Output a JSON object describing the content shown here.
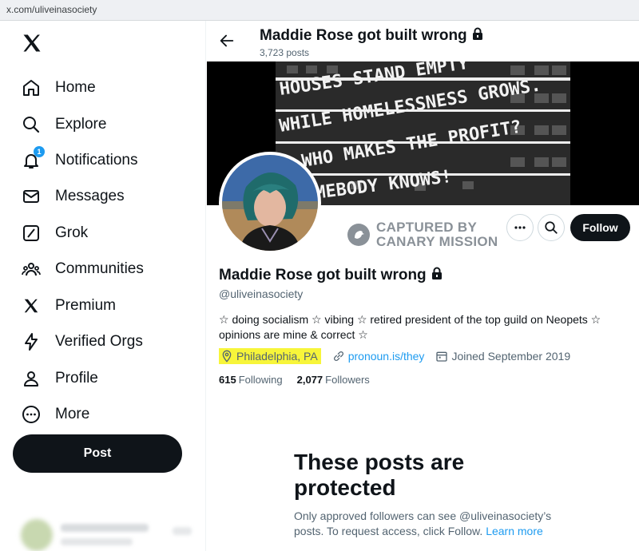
{
  "browser": {
    "url": "x.com/uliveinasociety"
  },
  "sidebar": {
    "logo_icon": "x-logo-icon",
    "items": [
      {
        "label": "Home",
        "icon": "home-icon"
      },
      {
        "label": "Explore",
        "icon": "search-icon"
      },
      {
        "label": "Notifications",
        "icon": "bell-icon",
        "badge": "1"
      },
      {
        "label": "Messages",
        "icon": "envelope-icon"
      },
      {
        "label": "Grok",
        "icon": "grok-icon"
      },
      {
        "label": "Communities",
        "icon": "people-icon"
      },
      {
        "label": "Premium",
        "icon": "x-logo-icon"
      },
      {
        "label": "Verified Orgs",
        "icon": "lightning-icon"
      },
      {
        "label": "Profile",
        "icon": "person-icon"
      },
      {
        "label": "More",
        "icon": "more-circle-icon"
      }
    ],
    "post_label": "Post"
  },
  "header": {
    "name": "Maddie Rose got built wrong",
    "post_count": "3,723 posts"
  },
  "banner": {
    "lines": [
      "HOUSES STAND EMPTY",
      "WHILE HOMELESSNESS GROWS.",
      "WHO MAKES THE PROFIT?",
      "SOMEBODY KNOWS!"
    ]
  },
  "watermark": {
    "line1": "CAPTURED BY",
    "line2": "CANARY MISSION"
  },
  "profile": {
    "name": "Maddie Rose got built wrong",
    "handle": "@uliveinasociety",
    "bio": "☆ doing socialism ☆ vibing ☆ retired president of the top guild on Neopets ☆ opinions are mine & correct ☆",
    "location": "Philadelphia, PA",
    "website": "pronoun.is/they",
    "joined": "Joined September 2019",
    "following_count": "615",
    "following_label": "Following",
    "followers_count": "2,077",
    "followers_label": "Followers",
    "follow_label": "Follow"
  },
  "protected": {
    "title": "These posts are protected",
    "text": "Only approved followers can see @uliveinasociety’s posts. To request access, click Follow.",
    "learn_more": "Learn more"
  },
  "colors": {
    "accent": "#1d9bf0",
    "highlight": "#f7f53a",
    "text": "#0f1419",
    "muted": "#536471"
  }
}
